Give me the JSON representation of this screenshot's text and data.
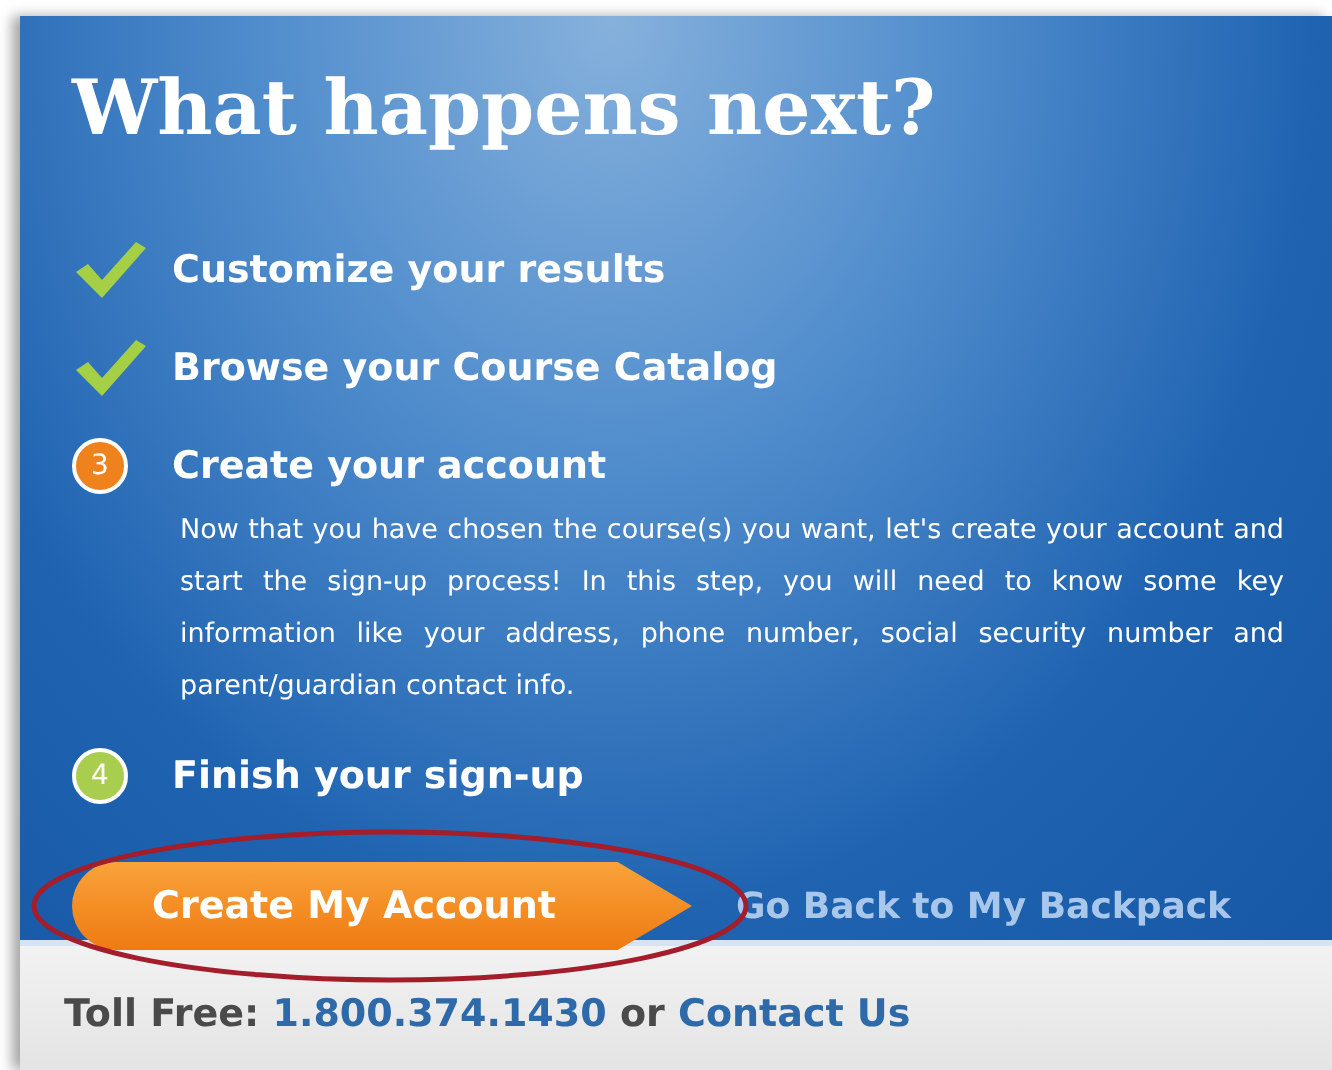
{
  "title": "What happens next?",
  "steps": [
    {
      "kind": "done",
      "label": "Customize your results"
    },
    {
      "kind": "done",
      "label": "Browse your Course Catalog"
    },
    {
      "kind": "current",
      "number": "3",
      "label": "Create your account",
      "description": "Now that you have chosen the course(s) you want, let's create your account and start the sign-up process! In this step, you will need to know some key information like your address, phone number, social security number and parent/guardian contact info."
    },
    {
      "kind": "upcoming",
      "number": "4",
      "label": "Finish your sign-up"
    }
  ],
  "primary_button": "Create My Account",
  "secondary_link": "Go Back to My Backpack",
  "footer": {
    "prefix": "Toll Free:",
    "phone": "1.800.374.1430",
    "middle": "or",
    "contact": "Contact Us"
  }
}
